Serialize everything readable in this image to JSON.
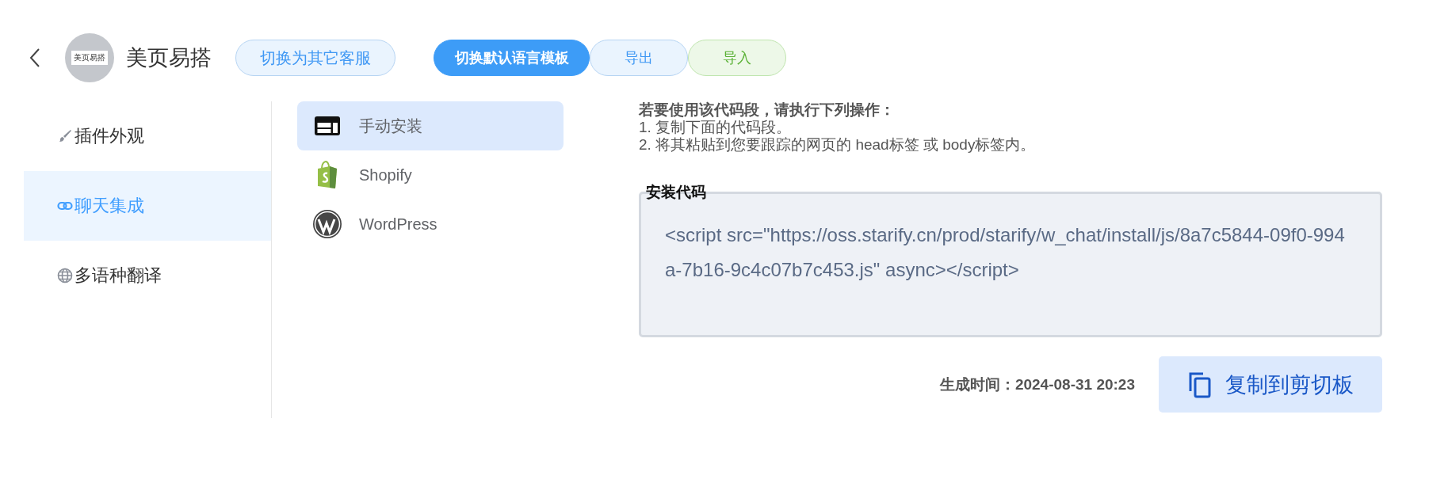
{
  "header": {
    "avatar_logo": "美页易搭",
    "title": "美页易搭",
    "switch_agent": "切换为其它客服",
    "actions": [
      {
        "label": "切换默认语言模板",
        "kind": "primary"
      },
      {
        "label": "导出",
        "kind": "blue"
      },
      {
        "label": "导入",
        "kind": "green"
      }
    ]
  },
  "sidebar": {
    "items": [
      {
        "label": "插件外观",
        "kind": "brush",
        "selected": false
      },
      {
        "label": "聊天集成",
        "kind": "link",
        "selected": true
      },
      {
        "label": "多语种翻译",
        "kind": "globe",
        "selected": false
      }
    ]
  },
  "platforms": [
    {
      "label": "手动安装",
      "kind": "manual",
      "selected": true
    },
    {
      "label": "Shopify",
      "kind": "bag",
      "selected": false
    },
    {
      "label": "WordPress",
      "kind": "wp",
      "selected": false
    }
  ],
  "instructions": {
    "heading": "若要使用该代码段，请执行下列操作：",
    "steps": [
      "1. 复制下面的代码段。",
      "2. 将其粘贴到您要跟踪的网页的 head标签 或 body标签内。"
    ]
  },
  "code_box": {
    "legend": "安装代码",
    "code": "<script src=\"https://oss.starify.cn/prod/starify/w_chat/install/js/8a7c5844-09f0-994a-7b16-9c4c07b7c453.js\" async></script>"
  },
  "footer": {
    "generated": "生成时间：2024-08-31 20:23",
    "copy_button": "复制到剪切板"
  }
}
